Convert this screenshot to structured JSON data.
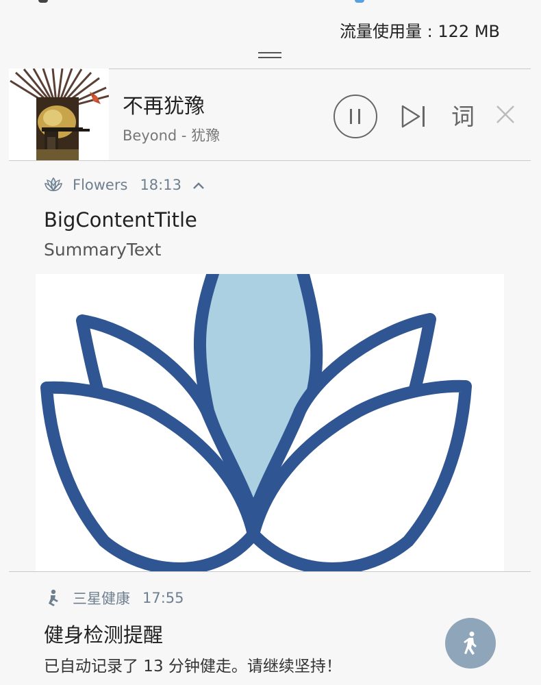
{
  "status_bar": {
    "data_usage": "流量使用量 : 122 MB"
  },
  "media_player": {
    "song_title": "不再犹豫",
    "artist_line": "Beyond - 犹豫",
    "album_art_icon": "album-cover-image",
    "controls": {
      "pause_icon": "pause-icon",
      "next_icon": "skip-next-icon",
      "lyrics_label": "词",
      "close_icon": "close-icon"
    }
  },
  "flowers_notification": {
    "app_name": "Flowers",
    "time": "18:13",
    "app_icon": "lotus-icon",
    "expand_icon": "chevron-up-icon",
    "title": "BigContentTitle",
    "summary": "SummaryText",
    "picture": "lotus-flower-image",
    "colors": {
      "stroke": "#2f5592",
      "fill_center": "#abd0e2",
      "header_text": "#6f7f8f"
    }
  },
  "health_notification": {
    "app_name": "三星健康",
    "time": "17:55",
    "app_icon": "health-person-icon",
    "title": "健身检测提醒",
    "text": "已自动记录了 13 分钟健走。请继续坚持！",
    "action_icon": "walking-person-icon",
    "colors": {
      "fab": "#8fa5b9"
    }
  }
}
